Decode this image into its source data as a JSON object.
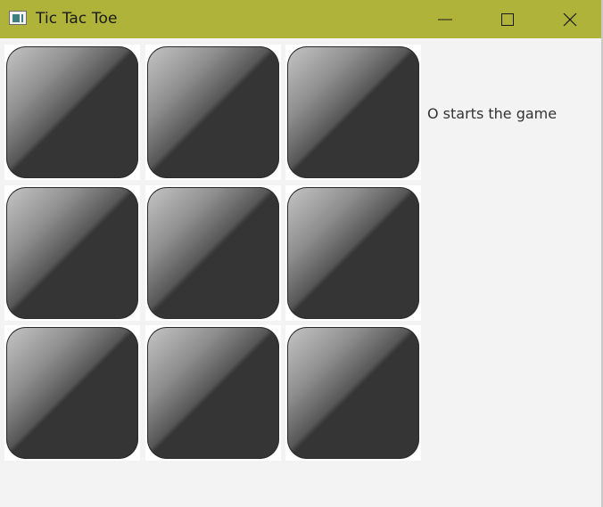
{
  "window": {
    "title": "Tic Tac Toe",
    "titlebar_color": "#b0b33a",
    "controls": {
      "minimize_icon": "minimize-icon",
      "maximize_icon": "maximize-icon",
      "close_icon": "close-icon"
    }
  },
  "board": {
    "cells": [
      {
        "value": ""
      },
      {
        "value": ""
      },
      {
        "value": ""
      },
      {
        "value": ""
      },
      {
        "value": ""
      },
      {
        "value": ""
      },
      {
        "value": ""
      },
      {
        "value": ""
      },
      {
        "value": ""
      }
    ],
    "tile_color": "#353535"
  },
  "status": {
    "text": "O starts the game"
  }
}
